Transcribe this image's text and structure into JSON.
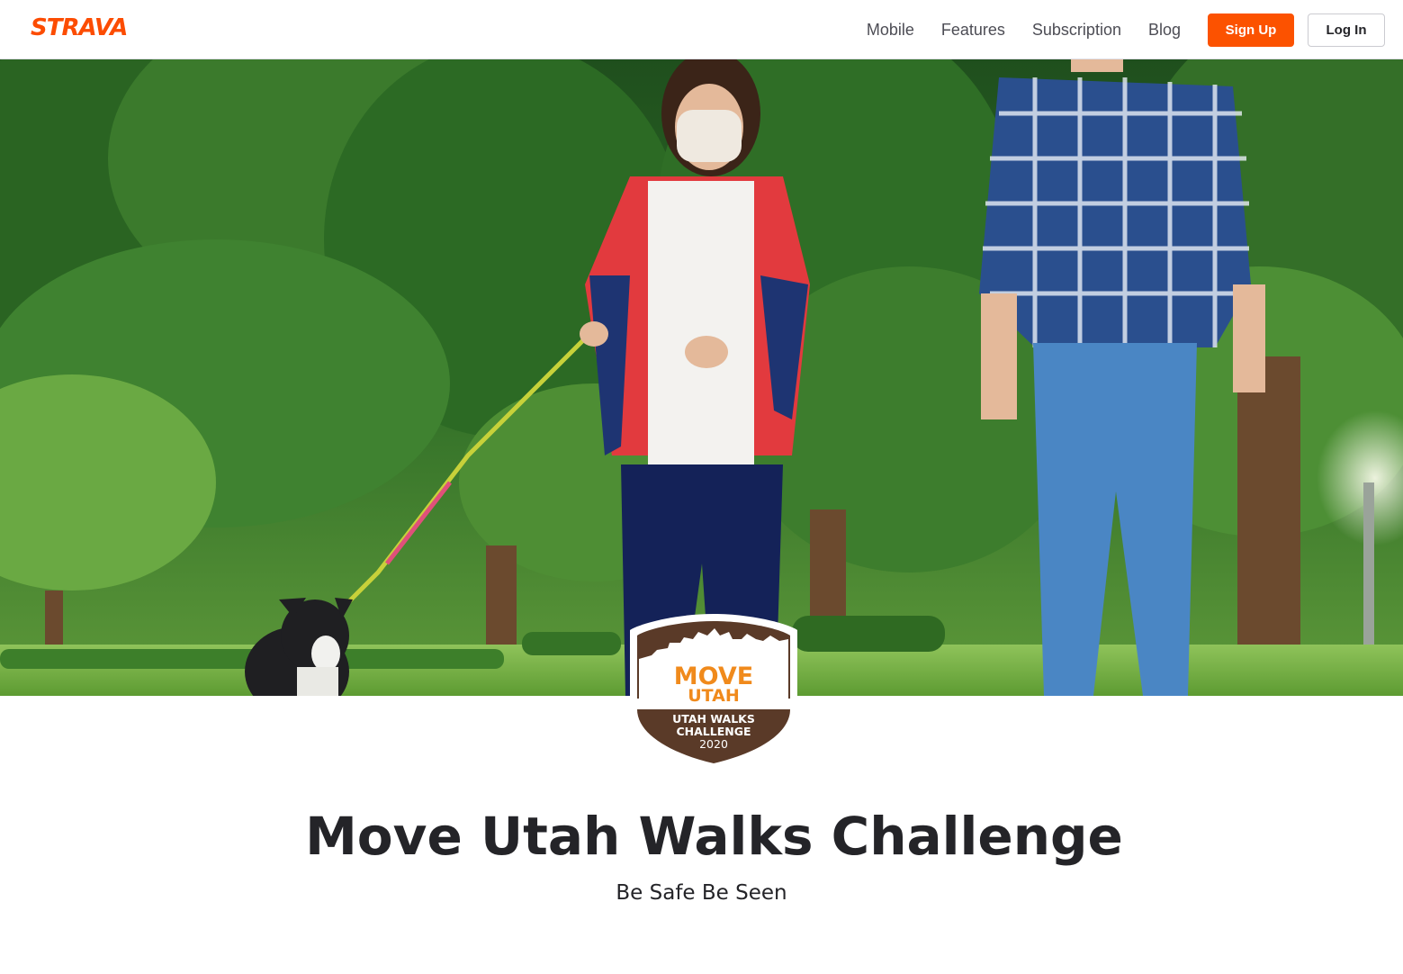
{
  "header": {
    "logo_text": "STRAVA",
    "nav": [
      {
        "label": "Mobile"
      },
      {
        "label": "Features"
      },
      {
        "label": "Subscription"
      },
      {
        "label": "Blog"
      }
    ],
    "signup_label": "Sign Up",
    "login_label": "Log In",
    "brand_color": "#fc4c02"
  },
  "badge": {
    "line1": "MOVE",
    "line2": "UTAH",
    "line3": "UTAH WALKS",
    "line4": "CHALLENGE",
    "line5": "2020",
    "colors": {
      "brown": "#5a3a28",
      "orange": "#f08a1c",
      "white": "#ffffff"
    }
  },
  "main": {
    "title": "Move Utah Walks Challenge",
    "subtitle": "Be Safe Be Seen"
  }
}
